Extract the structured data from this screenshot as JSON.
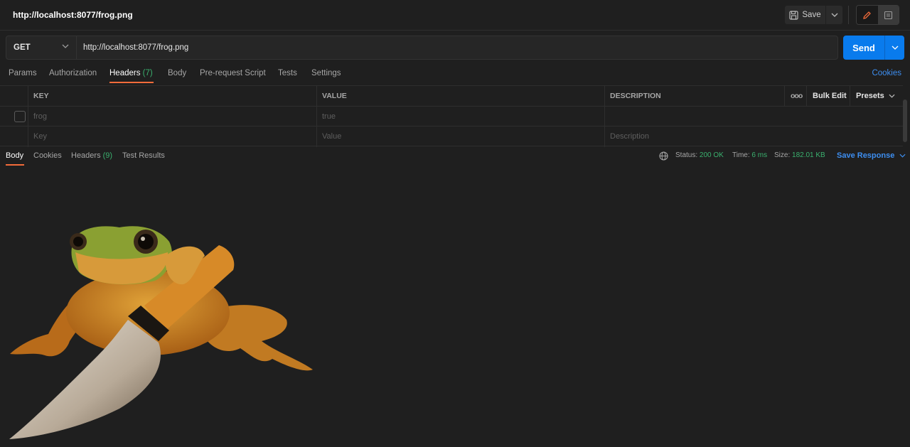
{
  "window": {
    "title": "http://localhost:8077/frog.png"
  },
  "toolbar": {
    "save_label": "Save"
  },
  "request": {
    "method": "GET",
    "url": "http://localhost:8077/frog.png",
    "send_label": "Send"
  },
  "request_tabs": [
    {
      "label": "Params",
      "count": ""
    },
    {
      "label": "Authorization",
      "count": ""
    },
    {
      "label": "Headers",
      "count": "(7)"
    },
    {
      "label": "Body",
      "count": ""
    },
    {
      "label": "Pre-request Script",
      "count": ""
    },
    {
      "label": "Tests",
      "count": ""
    },
    {
      "label": "Settings",
      "count": ""
    }
  ],
  "active_request_tab": "Headers",
  "cookies_link": "Cookies",
  "headers_table": {
    "columns": [
      "KEY",
      "VALUE",
      "DESCRIPTION"
    ],
    "more_icon": "ooo",
    "bulk_edit": "Bulk Edit",
    "presets": "Presets",
    "rows": [
      {
        "key": "frog",
        "value": "true",
        "description": ""
      }
    ],
    "placeholder": {
      "key": "Key",
      "value": "Value",
      "description": "Description"
    }
  },
  "response_tabs": [
    {
      "label": "Body",
      "count": ""
    },
    {
      "label": "Cookies",
      "count": ""
    },
    {
      "label": "Headers",
      "count": "(9)"
    },
    {
      "label": "Test Results",
      "count": ""
    }
  ],
  "response_meta": {
    "status_label": "Status:",
    "status_value": "200 OK",
    "time_label": "Time:",
    "time_value": "6 ms",
    "size_label": "Size:",
    "size_value": "182.01 KB",
    "save_response": "Save Response"
  },
  "colors": {
    "accent_blue": "#097bed",
    "link_blue": "#3d8ef0",
    "active_tab_underline": "#f26b3a",
    "success_green": "#3ab06e",
    "background": "#1f1f1f"
  },
  "icons": {
    "save": "save-icon",
    "edit": "pencil-icon",
    "doc": "documentation-icon",
    "globe": "globe-icon",
    "chevron": "chevron-down-icon"
  }
}
